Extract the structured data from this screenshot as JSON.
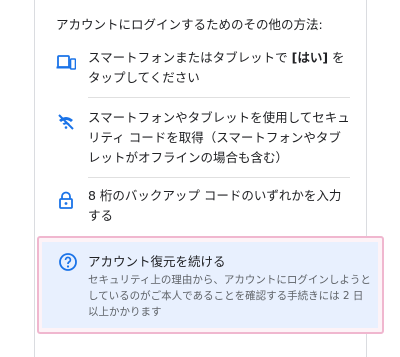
{
  "heading": "アカウントにログインするためのその他の方法:",
  "options": [
    {
      "icon": "phone-tablet-icon",
      "text_before": "スマートフォンまたはタブレットで ",
      "text_bold": "[はい]",
      "text_after": " をタップしてください"
    },
    {
      "icon": "phone-off-icon",
      "text": "スマートフォンやタブレットを使用してセキュリティ コードを取得（スマートフォンやタブレットがオフラインの場合も含む）"
    },
    {
      "icon": "lock-icon",
      "text": "8 桁のバックアップ コードのいずれかを入力する"
    }
  ],
  "recovery": {
    "icon": "help-circle-icon",
    "title": "アカウント復元を続ける",
    "description": "セキュリティ上の理由から、アカウントにログインしようとしているのがご本人であることを確認する手続きには 2 日以上かかります"
  },
  "colors": {
    "icon_blue": "#1a73e8",
    "highlight_border": "#f0b7cf",
    "recovery_bg": "#e8f0fe"
  }
}
